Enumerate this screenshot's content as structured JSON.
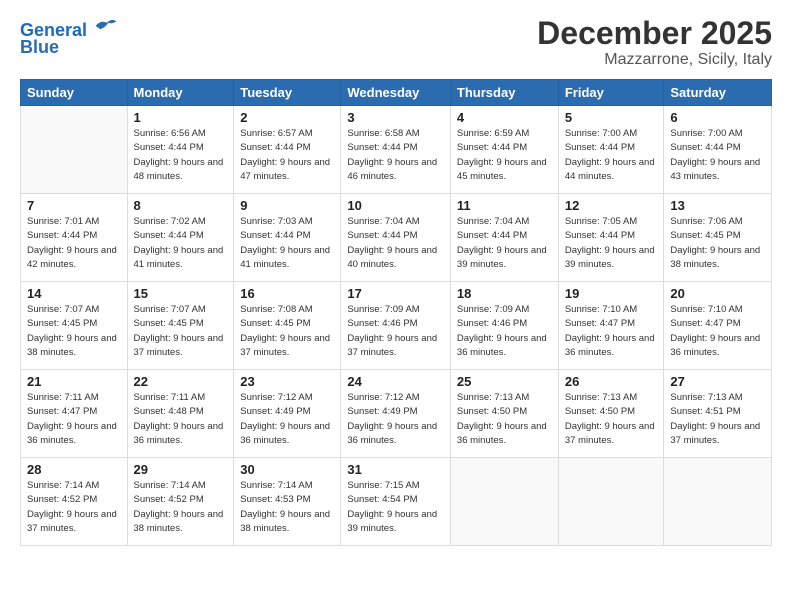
{
  "logo": {
    "line1": "General",
    "line2": "Blue"
  },
  "title": "December 2025",
  "subtitle": "Mazzarrone, Sicily, Italy",
  "weekdays": [
    "Sunday",
    "Monday",
    "Tuesday",
    "Wednesday",
    "Thursday",
    "Friday",
    "Saturday"
  ],
  "weeks": [
    [
      {
        "day": "",
        "sunrise": "",
        "sunset": "",
        "daylight": ""
      },
      {
        "day": "1",
        "sunrise": "Sunrise: 6:56 AM",
        "sunset": "Sunset: 4:44 PM",
        "daylight": "Daylight: 9 hours and 48 minutes."
      },
      {
        "day": "2",
        "sunrise": "Sunrise: 6:57 AM",
        "sunset": "Sunset: 4:44 PM",
        "daylight": "Daylight: 9 hours and 47 minutes."
      },
      {
        "day": "3",
        "sunrise": "Sunrise: 6:58 AM",
        "sunset": "Sunset: 4:44 PM",
        "daylight": "Daylight: 9 hours and 46 minutes."
      },
      {
        "day": "4",
        "sunrise": "Sunrise: 6:59 AM",
        "sunset": "Sunset: 4:44 PM",
        "daylight": "Daylight: 9 hours and 45 minutes."
      },
      {
        "day": "5",
        "sunrise": "Sunrise: 7:00 AM",
        "sunset": "Sunset: 4:44 PM",
        "daylight": "Daylight: 9 hours and 44 minutes."
      },
      {
        "day": "6",
        "sunrise": "Sunrise: 7:00 AM",
        "sunset": "Sunset: 4:44 PM",
        "daylight": "Daylight: 9 hours and 43 minutes."
      }
    ],
    [
      {
        "day": "7",
        "sunrise": "Sunrise: 7:01 AM",
        "sunset": "Sunset: 4:44 PM",
        "daylight": "Daylight: 9 hours and 42 minutes."
      },
      {
        "day": "8",
        "sunrise": "Sunrise: 7:02 AM",
        "sunset": "Sunset: 4:44 PM",
        "daylight": "Daylight: 9 hours and 41 minutes."
      },
      {
        "day": "9",
        "sunrise": "Sunrise: 7:03 AM",
        "sunset": "Sunset: 4:44 PM",
        "daylight": "Daylight: 9 hours and 41 minutes."
      },
      {
        "day": "10",
        "sunrise": "Sunrise: 7:04 AM",
        "sunset": "Sunset: 4:44 PM",
        "daylight": "Daylight: 9 hours and 40 minutes."
      },
      {
        "day": "11",
        "sunrise": "Sunrise: 7:04 AM",
        "sunset": "Sunset: 4:44 PM",
        "daylight": "Daylight: 9 hours and 39 minutes."
      },
      {
        "day": "12",
        "sunrise": "Sunrise: 7:05 AM",
        "sunset": "Sunset: 4:44 PM",
        "daylight": "Daylight: 9 hours and 39 minutes."
      },
      {
        "day": "13",
        "sunrise": "Sunrise: 7:06 AM",
        "sunset": "Sunset: 4:45 PM",
        "daylight": "Daylight: 9 hours and 38 minutes."
      }
    ],
    [
      {
        "day": "14",
        "sunrise": "Sunrise: 7:07 AM",
        "sunset": "Sunset: 4:45 PM",
        "daylight": "Daylight: 9 hours and 38 minutes."
      },
      {
        "day": "15",
        "sunrise": "Sunrise: 7:07 AM",
        "sunset": "Sunset: 4:45 PM",
        "daylight": "Daylight: 9 hours and 37 minutes."
      },
      {
        "day": "16",
        "sunrise": "Sunrise: 7:08 AM",
        "sunset": "Sunset: 4:45 PM",
        "daylight": "Daylight: 9 hours and 37 minutes."
      },
      {
        "day": "17",
        "sunrise": "Sunrise: 7:09 AM",
        "sunset": "Sunset: 4:46 PM",
        "daylight": "Daylight: 9 hours and 37 minutes."
      },
      {
        "day": "18",
        "sunrise": "Sunrise: 7:09 AM",
        "sunset": "Sunset: 4:46 PM",
        "daylight": "Daylight: 9 hours and 36 minutes."
      },
      {
        "day": "19",
        "sunrise": "Sunrise: 7:10 AM",
        "sunset": "Sunset: 4:47 PM",
        "daylight": "Daylight: 9 hours and 36 minutes."
      },
      {
        "day": "20",
        "sunrise": "Sunrise: 7:10 AM",
        "sunset": "Sunset: 4:47 PM",
        "daylight": "Daylight: 9 hours and 36 minutes."
      }
    ],
    [
      {
        "day": "21",
        "sunrise": "Sunrise: 7:11 AM",
        "sunset": "Sunset: 4:47 PM",
        "daylight": "Daylight: 9 hours and 36 minutes."
      },
      {
        "day": "22",
        "sunrise": "Sunrise: 7:11 AM",
        "sunset": "Sunset: 4:48 PM",
        "daylight": "Daylight: 9 hours and 36 minutes."
      },
      {
        "day": "23",
        "sunrise": "Sunrise: 7:12 AM",
        "sunset": "Sunset: 4:49 PM",
        "daylight": "Daylight: 9 hours and 36 minutes."
      },
      {
        "day": "24",
        "sunrise": "Sunrise: 7:12 AM",
        "sunset": "Sunset: 4:49 PM",
        "daylight": "Daylight: 9 hours and 36 minutes."
      },
      {
        "day": "25",
        "sunrise": "Sunrise: 7:13 AM",
        "sunset": "Sunset: 4:50 PM",
        "daylight": "Daylight: 9 hours and 36 minutes."
      },
      {
        "day": "26",
        "sunrise": "Sunrise: 7:13 AM",
        "sunset": "Sunset: 4:50 PM",
        "daylight": "Daylight: 9 hours and 37 minutes."
      },
      {
        "day": "27",
        "sunrise": "Sunrise: 7:13 AM",
        "sunset": "Sunset: 4:51 PM",
        "daylight": "Daylight: 9 hours and 37 minutes."
      }
    ],
    [
      {
        "day": "28",
        "sunrise": "Sunrise: 7:14 AM",
        "sunset": "Sunset: 4:52 PM",
        "daylight": "Daylight: 9 hours and 37 minutes."
      },
      {
        "day": "29",
        "sunrise": "Sunrise: 7:14 AM",
        "sunset": "Sunset: 4:52 PM",
        "daylight": "Daylight: 9 hours and 38 minutes."
      },
      {
        "day": "30",
        "sunrise": "Sunrise: 7:14 AM",
        "sunset": "Sunset: 4:53 PM",
        "daylight": "Daylight: 9 hours and 38 minutes."
      },
      {
        "day": "31",
        "sunrise": "Sunrise: 7:15 AM",
        "sunset": "Sunset: 4:54 PM",
        "daylight": "Daylight: 9 hours and 39 minutes."
      },
      {
        "day": "",
        "sunrise": "",
        "sunset": "",
        "daylight": ""
      },
      {
        "day": "",
        "sunrise": "",
        "sunset": "",
        "daylight": ""
      },
      {
        "day": "",
        "sunrise": "",
        "sunset": "",
        "daylight": ""
      }
    ]
  ]
}
